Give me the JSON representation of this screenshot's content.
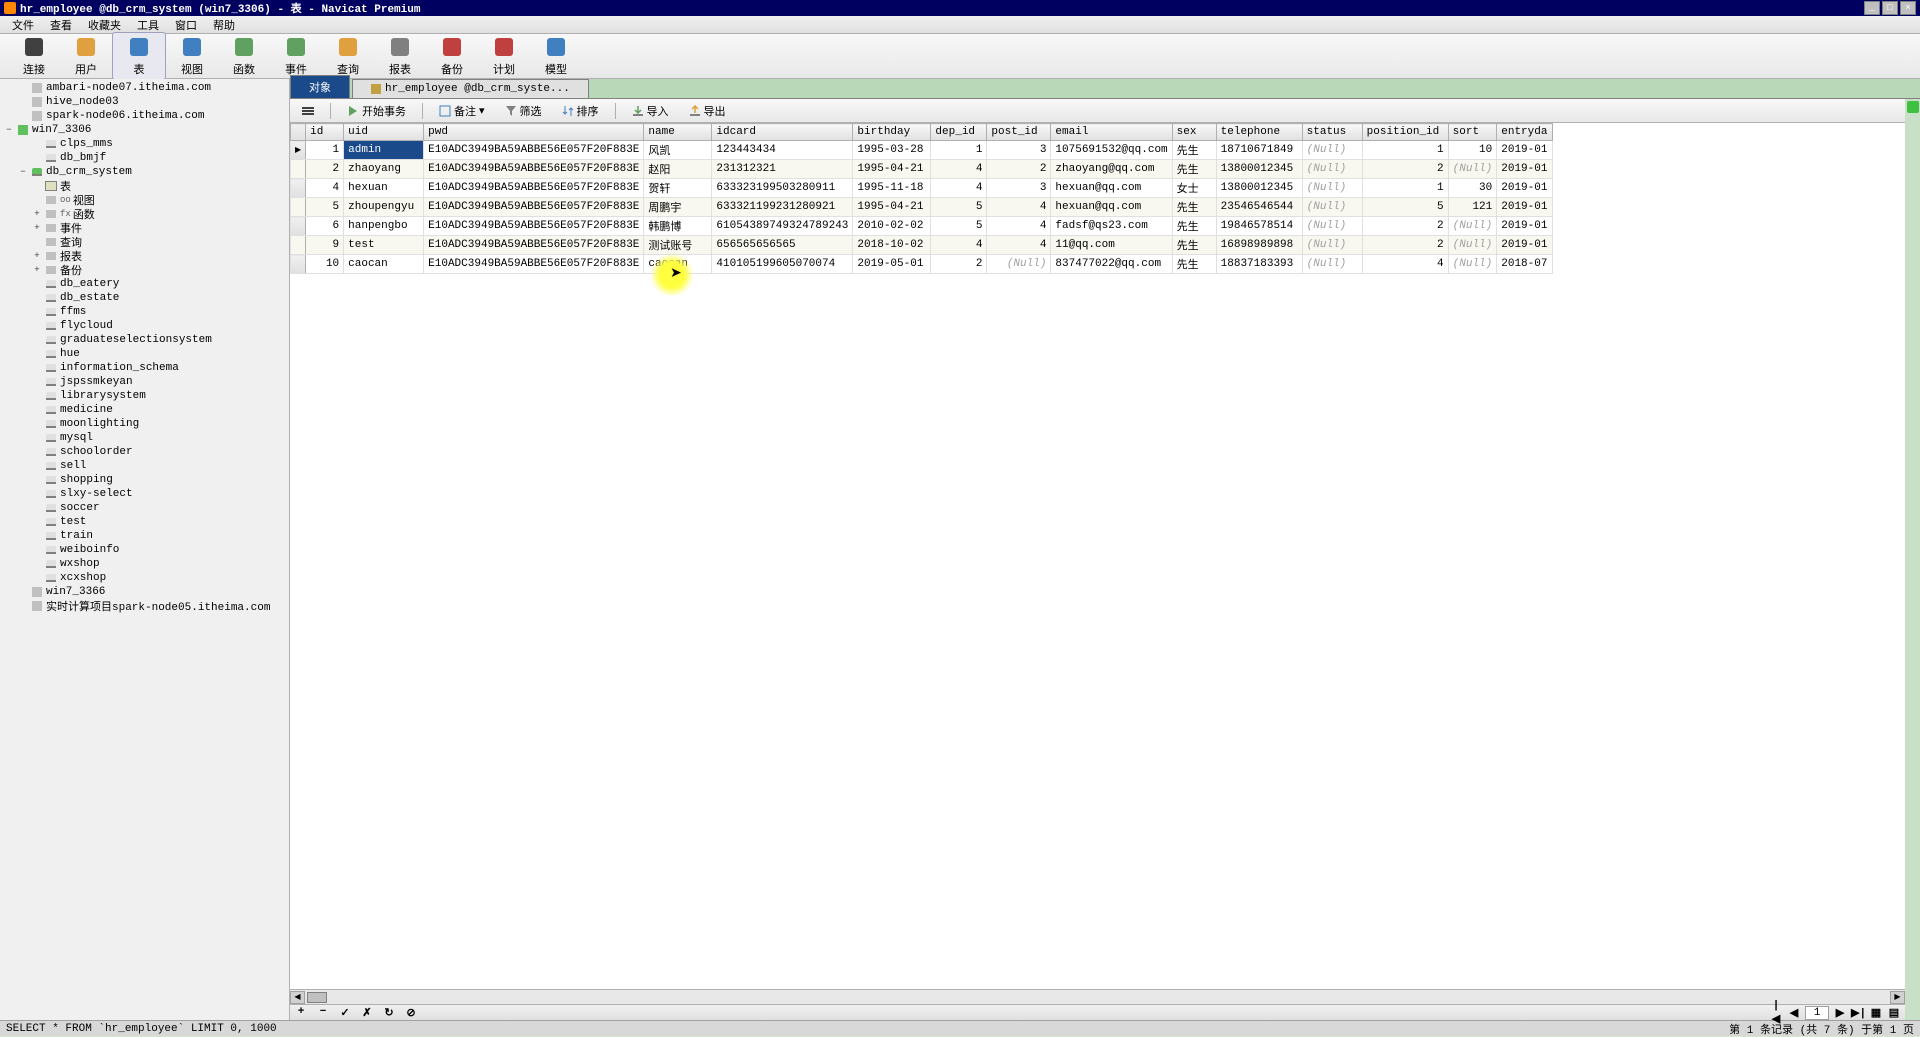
{
  "titlebar": "hr_employee @db_crm_system (win7_3306) - 表 - Navicat Premium",
  "menus": [
    "文件",
    "查看",
    "收藏夹",
    "工具",
    "窗口",
    "帮助"
  ],
  "toolbar": [
    {
      "label": "连接",
      "color": "#404040"
    },
    {
      "label": "用户",
      "color": "#e0a040"
    },
    {
      "label": "表",
      "color": "#4080c0",
      "active": true
    },
    {
      "label": "视图",
      "color": "#4080c0"
    },
    {
      "label": "函数",
      "color": "#60a060"
    },
    {
      "label": "事件",
      "color": "#60a060"
    },
    {
      "label": "查询",
      "color": "#e0a040"
    },
    {
      "label": "报表",
      "color": "#808080"
    },
    {
      "label": "备份",
      "color": "#c04040"
    },
    {
      "label": "计划",
      "color": "#c04040"
    },
    {
      "label": "模型",
      "color": "#4080c0"
    }
  ],
  "tree": [
    {
      "level": 1,
      "toggle": "",
      "icon": "conn",
      "label": "ambari-node07.itheima.com"
    },
    {
      "level": 1,
      "toggle": "",
      "icon": "conn",
      "label": "hive_node03"
    },
    {
      "level": 1,
      "toggle": "",
      "icon": "conn",
      "label": "spark-node06.itheima.com"
    },
    {
      "level": 0,
      "toggle": "−",
      "icon": "conn-active",
      "label": "win7_3306"
    },
    {
      "level": 2,
      "toggle": "",
      "icon": "db",
      "label": "clps_mms"
    },
    {
      "level": 2,
      "toggle": "",
      "icon": "db",
      "label": "db_bmjf"
    },
    {
      "level": 1,
      "toggle": "−",
      "icon": "db-active",
      "label": "db_crm_system"
    },
    {
      "level": 2,
      "toggle": "",
      "icon": "table",
      "label": "表"
    },
    {
      "level": 2,
      "toggle": "",
      "icon": "folder",
      "label": "视图",
      "prefix": "oo"
    },
    {
      "level": 2,
      "toggle": "+",
      "icon": "folder",
      "label": "函数",
      "prefix": "fx"
    },
    {
      "level": 2,
      "toggle": "+",
      "icon": "folder",
      "label": "事件"
    },
    {
      "level": 2,
      "toggle": "",
      "icon": "folder",
      "label": "查询"
    },
    {
      "level": 2,
      "toggle": "+",
      "icon": "folder",
      "label": "报表"
    },
    {
      "level": 2,
      "toggle": "+",
      "icon": "folder",
      "label": "备份"
    },
    {
      "level": 2,
      "toggle": "",
      "icon": "db",
      "label": "db_eatery"
    },
    {
      "level": 2,
      "toggle": "",
      "icon": "db",
      "label": "db_estate"
    },
    {
      "level": 2,
      "toggle": "",
      "icon": "db",
      "label": "ffms"
    },
    {
      "level": 2,
      "toggle": "",
      "icon": "db",
      "label": "flycloud"
    },
    {
      "level": 2,
      "toggle": "",
      "icon": "db",
      "label": "graduateselectionsystem"
    },
    {
      "level": 2,
      "toggle": "",
      "icon": "db",
      "label": "hue"
    },
    {
      "level": 2,
      "toggle": "",
      "icon": "db",
      "label": "information_schema"
    },
    {
      "level": 2,
      "toggle": "",
      "icon": "db",
      "label": "jspssmkeyan"
    },
    {
      "level": 2,
      "toggle": "",
      "icon": "db",
      "label": "librarysystem"
    },
    {
      "level": 2,
      "toggle": "",
      "icon": "db",
      "label": "medicine"
    },
    {
      "level": 2,
      "toggle": "",
      "icon": "db",
      "label": "moonlighting"
    },
    {
      "level": 2,
      "toggle": "",
      "icon": "db",
      "label": "mysql"
    },
    {
      "level": 2,
      "toggle": "",
      "icon": "db",
      "label": "schoolorder"
    },
    {
      "level": 2,
      "toggle": "",
      "icon": "db",
      "label": "sell"
    },
    {
      "level": 2,
      "toggle": "",
      "icon": "db",
      "label": "shopping"
    },
    {
      "level": 2,
      "toggle": "",
      "icon": "db",
      "label": "slxy-select"
    },
    {
      "level": 2,
      "toggle": "",
      "icon": "db",
      "label": "soccer"
    },
    {
      "level": 2,
      "toggle": "",
      "icon": "db",
      "label": "test"
    },
    {
      "level": 2,
      "toggle": "",
      "icon": "db",
      "label": "train"
    },
    {
      "level": 2,
      "toggle": "",
      "icon": "db",
      "label": "weiboinfo"
    },
    {
      "level": 2,
      "toggle": "",
      "icon": "db",
      "label": "wxshop"
    },
    {
      "level": 2,
      "toggle": "",
      "icon": "db",
      "label": "xcxshop"
    },
    {
      "level": 1,
      "toggle": "",
      "icon": "conn",
      "label": "win7_3366"
    },
    {
      "level": 1,
      "toggle": "",
      "icon": "conn",
      "label": "实时计算项目spark-node05.itheima.com"
    }
  ],
  "tabs": [
    {
      "label": "对象",
      "active": true
    },
    {
      "label": "hr_employee @db_crm_syste...",
      "active": false
    }
  ],
  "actions": {
    "begin": "开始事务",
    "memo": "备注",
    "filter": "筛选",
    "sort": "排序",
    "import": "导入",
    "export": "导出"
  },
  "columns": [
    "id",
    "uid",
    "pwd",
    "name",
    "idcard",
    "birthday",
    "dep_id",
    "post_id",
    "email",
    "sex",
    "telephone",
    "status",
    "position_id",
    "sort",
    "entryda"
  ],
  "rows": [
    {
      "id": "1",
      "uid": "admin",
      "pwd": "E10ADC3949BA59ABBE56E057F20F883E",
      "name": "风凯",
      "idcard": "123443434",
      "birthday": "1995-03-28",
      "dep_id": "1",
      "post_id": "3",
      "email": "1075691532@qq.com",
      "sex": "先生",
      "telephone": "18710671849",
      "status": "(Null)",
      "position_id": "1",
      "sort": "10",
      "entry": "2019-01",
      "active": true
    },
    {
      "id": "2",
      "uid": "zhaoyang",
      "pwd": "E10ADC3949BA59ABBE56E057F20F883E",
      "name": "赵阳",
      "idcard": "231312321",
      "birthday": "1995-04-21",
      "dep_id": "4",
      "post_id": "2",
      "email": "zhaoyang@qq.com",
      "sex": "先生",
      "telephone": "13800012345",
      "status": "(Null)",
      "position_id": "2",
      "sort": "(Null)",
      "entry": "2019-01"
    },
    {
      "id": "4",
      "uid": "hexuan",
      "pwd": "E10ADC3949BA59ABBE56E057F20F883E",
      "name": "贺轩",
      "idcard": "633323199503280911",
      "birthday": "1995-11-18",
      "dep_id": "4",
      "post_id": "3",
      "email": "hexuan@qq.com",
      "sex": "女士",
      "telephone": "13800012345",
      "status": "(Null)",
      "position_id": "1",
      "sort": "30",
      "entry": "2019-01"
    },
    {
      "id": "5",
      "uid": "zhoupengyu",
      "pwd": "E10ADC3949BA59ABBE56E057F20F883E",
      "name": "周鹏宇",
      "idcard": "633321199231280921",
      "birthday": "1995-04-21",
      "dep_id": "5",
      "post_id": "4",
      "email": "hexuan@qq.com",
      "sex": "先生",
      "telephone": "23546546544",
      "status": "(Null)",
      "position_id": "5",
      "sort": "121",
      "entry": "2019-01"
    },
    {
      "id": "6",
      "uid": "hanpengbo",
      "pwd": "E10ADC3949BA59ABBE56E057F20F883E",
      "name": "韩鹏博",
      "idcard": "61054389749324789243",
      "birthday": "2010-02-02",
      "dep_id": "5",
      "post_id": "4",
      "email": "fadsf@qs23.com",
      "sex": "先生",
      "telephone": "19846578514",
      "status": "(Null)",
      "position_id": "2",
      "sort": "(Null)",
      "entry": "2019-01"
    },
    {
      "id": "9",
      "uid": "test",
      "pwd": "E10ADC3949BA59ABBE56E057F20F883E",
      "name": "测试账号",
      "idcard": "656565656565",
      "birthday": "2018-10-02",
      "dep_id": "4",
      "post_id": "4",
      "email": "11@qq.com",
      "sex": "先生",
      "telephone": "16898989898",
      "status": "(Null)",
      "position_id": "2",
      "sort": "(Null)",
      "entry": "2019-01"
    },
    {
      "id": "10",
      "uid": "caocan",
      "pwd": "E10ADC3949BA59ABBE56E057F20F883E",
      "name": "caocan",
      "idcard": "410105199605070074",
      "birthday": "2019-05-01",
      "dep_id": "2",
      "post_id": "(Null)",
      "email": "837477022@qq.com",
      "sex": "先生",
      "telephone": "18837183393",
      "status": "(Null)",
      "position_id": "4",
      "sort": "(Null)",
      "entry": "2018-07"
    }
  ],
  "nav": {
    "page_input": "1"
  },
  "status": {
    "left": "SELECT * FROM `hr_employee` LIMIT 0, 1000",
    "right": "第 1 条记录 (共 7 条) 于第 1 页"
  }
}
